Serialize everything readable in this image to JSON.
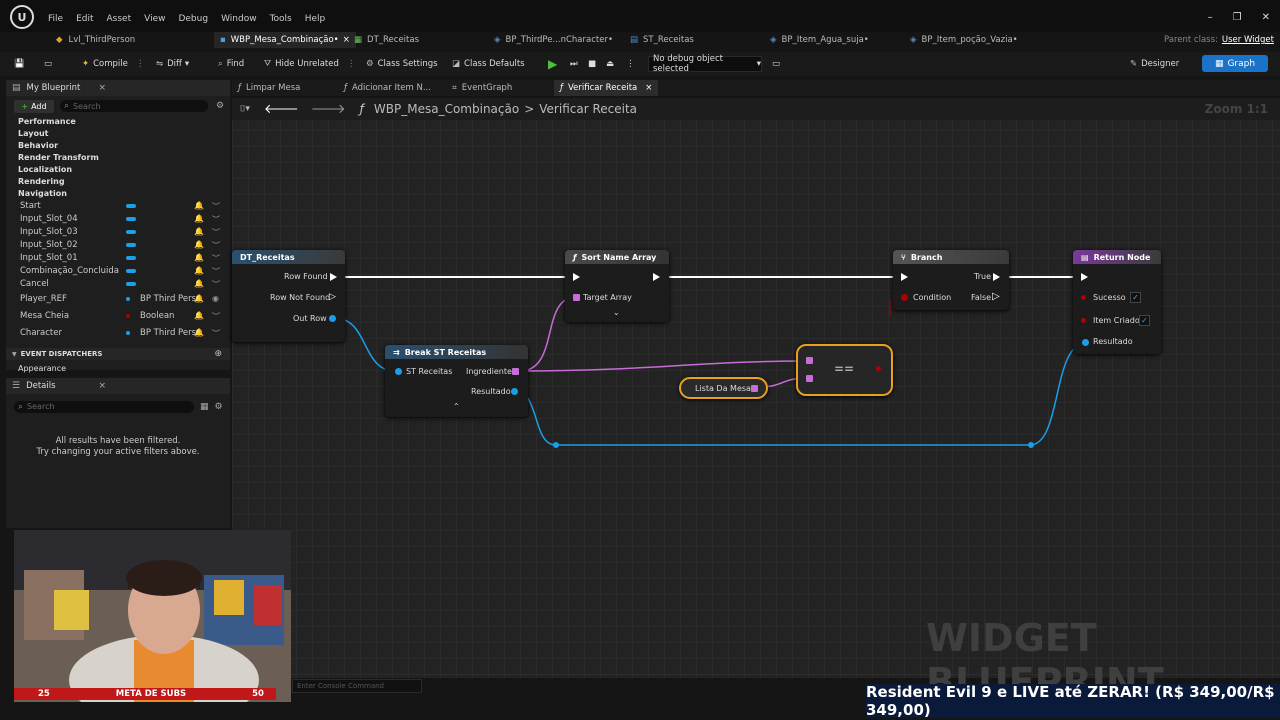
{
  "menubar": {
    "menus": [
      "File",
      "Edit",
      "Asset",
      "View",
      "Debug",
      "Window",
      "Tools",
      "Help"
    ]
  },
  "asset_tabs": [
    {
      "label": "Lvl_ThirdPerson",
      "close": ""
    },
    {
      "label": "WBP_Mesa_Combinação•",
      "close": "×"
    },
    {
      "label": "DT_Receitas",
      "close": ""
    },
    {
      "label": "BP_ThirdPe...nCharacter•",
      "close": ""
    },
    {
      "label": "ST_Receitas",
      "close": ""
    },
    {
      "label": "BP_Item_Agua_suja•",
      "close": ""
    },
    {
      "label": "BP_Item_poção_Vazia•",
      "close": ""
    }
  ],
  "parent_class": {
    "label": "Parent class:",
    "value": "User Widget"
  },
  "toolbar": {
    "compile": "Compile",
    "diff": "Diff",
    "find": "Find",
    "hide_unrelated": "Hide Unrelated",
    "class_settings": "Class Settings",
    "class_defaults": "Class Defaults",
    "debug_select": "No debug object selected",
    "designer": "Designer",
    "graph": "Graph"
  },
  "my_blueprint": {
    "title": "My Blueprint",
    "close": "×",
    "add": "Add",
    "search_placeholder": "Search",
    "sections": [
      "Performance",
      "Layout",
      "Behavior",
      "Render Transform",
      "Localization",
      "Rendering",
      "Navigation"
    ],
    "variables": [
      {
        "name": "Start",
        "type": ""
      },
      {
        "name": "Input_Slot_04",
        "type": ""
      },
      {
        "name": "Input_Slot_03",
        "type": ""
      },
      {
        "name": "Input_Slot_02",
        "type": ""
      },
      {
        "name": "Input_Slot_01",
        "type": ""
      },
      {
        "name": "Combinação_Concluida",
        "type": ""
      },
      {
        "name": "Cancel",
        "type": ""
      },
      {
        "name": "Player_REF",
        "type": "BP Third Pers"
      },
      {
        "name": "Mesa Cheia",
        "type": "Boolean"
      },
      {
        "name": "Character",
        "type": "BP Third Pers"
      }
    ],
    "event_dispatchers": "EVENT DISPATCHERS",
    "appearance": "Appearance"
  },
  "details": {
    "title": "Details",
    "close": "×",
    "search_placeholder": "Search",
    "empty_line1": "All results have been filtered.",
    "empty_line2": "Try changing your active filters above."
  },
  "graph_tabs": [
    {
      "label": "Limpar Mesa",
      "close": ""
    },
    {
      "label": "Adicionar Item N...",
      "close": ""
    },
    {
      "label": "EventGraph",
      "close": ""
    },
    {
      "label": "Verificar Receita",
      "close": "×"
    }
  ],
  "breadcrumb": {
    "root": "WBP_Mesa_Combinação",
    "sep": ">",
    "leaf": "Verificar Receita",
    "zoom": "Zoom 1:1"
  },
  "nodes": {
    "get_row": {
      "title": "DT_Receitas",
      "pins": [
        "Row Found",
        "Row Not Found",
        "Out Row"
      ]
    },
    "sort": {
      "title": "Sort Name Array",
      "pins": [
        "Target Array"
      ]
    },
    "branch": {
      "title": "Branch",
      "pins": [
        "True",
        "False",
        "Condition"
      ]
    },
    "return": {
      "title": "Return Node",
      "pins": [
        "Sucesso",
        "Item Criado",
        "Resultado"
      ]
    },
    "break": {
      "title": "Break ST Receitas",
      "pins": [
        "ST Receitas",
        "Ingredientes",
        "Resultado"
      ]
    },
    "var_get": {
      "title": "Lista Da Mesa"
    },
    "equal": {
      "symbol": "=="
    }
  },
  "watermark": "WIDGET BLUEPRINT",
  "console_placeholder": "Enter Console Command",
  "subs_bar": {
    "left": "25",
    "center": "META DE SUBS",
    "right": "50"
  },
  "banner": "Resident Evil 9 e LIVE até ZERAR! (R$ 349,00/R$ 349,00)",
  "colors": {
    "accent": "#1a73c8",
    "exec": "#ffffff",
    "struct": "#1aa0e8",
    "array": "#c86cd8",
    "bool": "#b00000"
  }
}
